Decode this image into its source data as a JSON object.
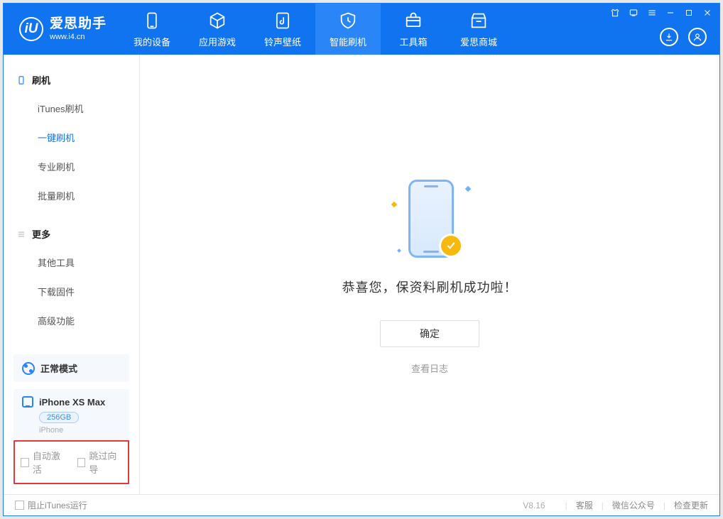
{
  "app": {
    "title": "爱思助手",
    "subtitle": "www.i4.cn",
    "logo_letter": "iU"
  },
  "nav": {
    "items": [
      {
        "label": "我的设备"
      },
      {
        "label": "应用游戏"
      },
      {
        "label": "铃声壁纸"
      },
      {
        "label": "智能刷机"
      },
      {
        "label": "工具箱"
      },
      {
        "label": "爱思商城"
      }
    ]
  },
  "sidebar": {
    "group1": {
      "title": "刷机",
      "items": [
        {
          "label": "iTunes刷机"
        },
        {
          "label": "一键刷机"
        },
        {
          "label": "专业刷机"
        },
        {
          "label": "批量刷机"
        }
      ]
    },
    "group2": {
      "title": "更多",
      "items": [
        {
          "label": "其他工具"
        },
        {
          "label": "下载固件"
        },
        {
          "label": "高级功能"
        }
      ]
    },
    "mode": {
      "label": "正常模式"
    },
    "device": {
      "name": "iPhone XS Max",
      "capacity": "256GB",
      "type": "iPhone"
    },
    "checks": {
      "auto_activate": "自动激活",
      "skip_guide": "跳过向导"
    }
  },
  "main": {
    "success_text": "恭喜您，保资料刷机成功啦！",
    "ok_button": "确定",
    "view_log": "查看日志"
  },
  "footer": {
    "block_itunes": "阻止iTunes运行",
    "version": "V8.16",
    "links": {
      "support": "客服",
      "wechat": "微信公众号",
      "update": "检查更新"
    }
  }
}
